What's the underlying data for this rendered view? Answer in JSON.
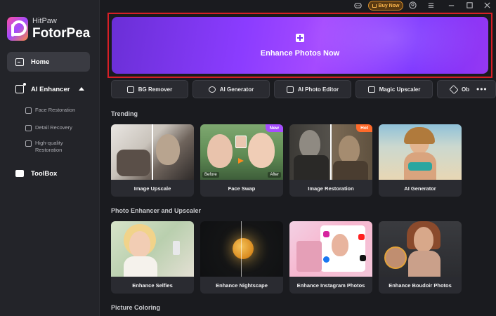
{
  "app": {
    "brand": "HitPaw",
    "product": "FotorPea"
  },
  "titlebar": {
    "buy_label": "Buy Now"
  },
  "sidebar": {
    "home": "Home",
    "ai_enhancer": "AI Enhancer",
    "sub_items": [
      "Face Restoration",
      "Detail Recovery",
      "High-quality Restoration"
    ],
    "toolbox": "ToolBox"
  },
  "banner": {
    "label": "Enhance Photos Now"
  },
  "tools": [
    "BG Remover",
    "AI Generator",
    "AI Photo Editor",
    "Magic Upscaler",
    "Ob"
  ],
  "sections": {
    "trending": "Trending",
    "enhancer": "Photo Enhancer and Upscaler",
    "coloring": "Picture Coloring"
  },
  "trending_cards": [
    {
      "label": "Image Upscale"
    },
    {
      "label": "Face Swap",
      "badge": "New",
      "before": "Before",
      "after": "After"
    },
    {
      "label": "Image Restoration",
      "badge": "Hot"
    },
    {
      "label": "AI Generator"
    }
  ],
  "enhancer_cards": [
    {
      "label": "Enhance Selfies"
    },
    {
      "label": "Enhance Nightscape"
    },
    {
      "label": "Enhance Instagram Photos"
    },
    {
      "label": "Enhance Boudoir Photos"
    }
  ],
  "colors": {
    "accent": "#8b3cff",
    "highlight_border": "#d61f26",
    "badge_new": "#a64dff",
    "badge_hot": "#ff6a2a"
  }
}
